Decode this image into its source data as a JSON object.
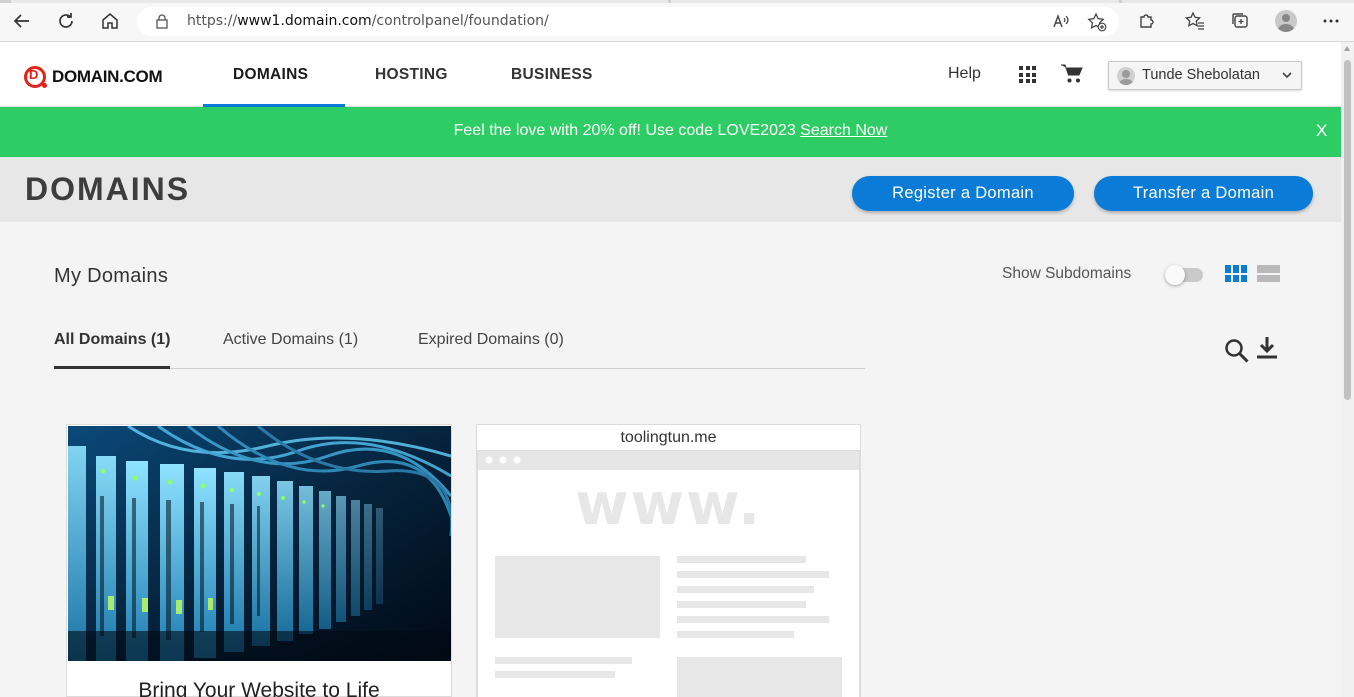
{
  "browser": {
    "url_prefix": "https://",
    "url_host": "www1.domain.com",
    "url_path": "/controlpanel/foundation/"
  },
  "site": {
    "logo_text": "DOMAIN.COM",
    "nav": [
      "DOMAINS",
      "HOSTING",
      "BUSINESS"
    ],
    "help_label": "Help",
    "user_name": "Tunde Shebolatan"
  },
  "promo": {
    "text": "Feel the love with 20% off! Use code LOVE2023 ",
    "link": "Search Now",
    "close": "X"
  },
  "page": {
    "title": "DOMAINS",
    "register_button": "Register a Domain",
    "transfer_button": "Transfer a Domain"
  },
  "my_domains": {
    "title": "My Domains",
    "show_subdomains_label": "Show Subdomains",
    "show_subdomains_on": false,
    "view_mode": "grid",
    "tabs": [
      "All Domains (1)",
      "Active Domains (1)",
      "Expired Domains (0)"
    ],
    "active_tab": 0
  },
  "cards": {
    "promo_caption": "Bring Your Website to Life",
    "domain_name": "toolingtun.me",
    "placeholder_text": "www."
  },
  "colors": {
    "brand_blue": "#0a7bd6",
    "promo_green": "#2ecc65",
    "logo_red": "#e2231a"
  }
}
